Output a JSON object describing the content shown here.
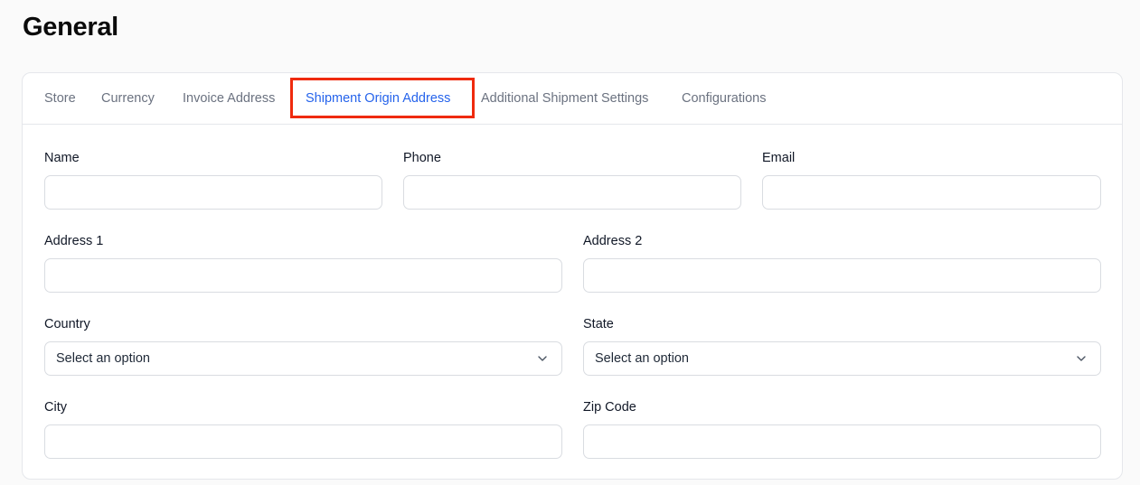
{
  "page": {
    "title": "General"
  },
  "tabs": [
    {
      "label": "Store",
      "active": false
    },
    {
      "label": "Currency",
      "active": false
    },
    {
      "label": "Invoice Address",
      "active": false
    },
    {
      "label": "Shipment Origin Address",
      "active": true
    },
    {
      "label": "Additional Shipment Settings",
      "active": false
    },
    {
      "label": "Configurations",
      "active": false
    }
  ],
  "colors": {
    "accent": "#2563eb",
    "highlight": "#ef2a0d",
    "border": "#e5e7eb"
  },
  "form": {
    "name": {
      "label": "Name",
      "value": ""
    },
    "phone": {
      "label": "Phone",
      "value": ""
    },
    "email": {
      "label": "Email",
      "value": ""
    },
    "address1": {
      "label": "Address 1",
      "value": ""
    },
    "address2": {
      "label": "Address 2",
      "value": ""
    },
    "country": {
      "label": "Country",
      "selected": "Select an option",
      "icon": "chevron-down-icon"
    },
    "state": {
      "label": "State",
      "selected": "Select an option",
      "icon": "chevron-down-icon"
    },
    "city": {
      "label": "City",
      "value": ""
    },
    "zip": {
      "label": "Zip Code",
      "value": ""
    }
  }
}
